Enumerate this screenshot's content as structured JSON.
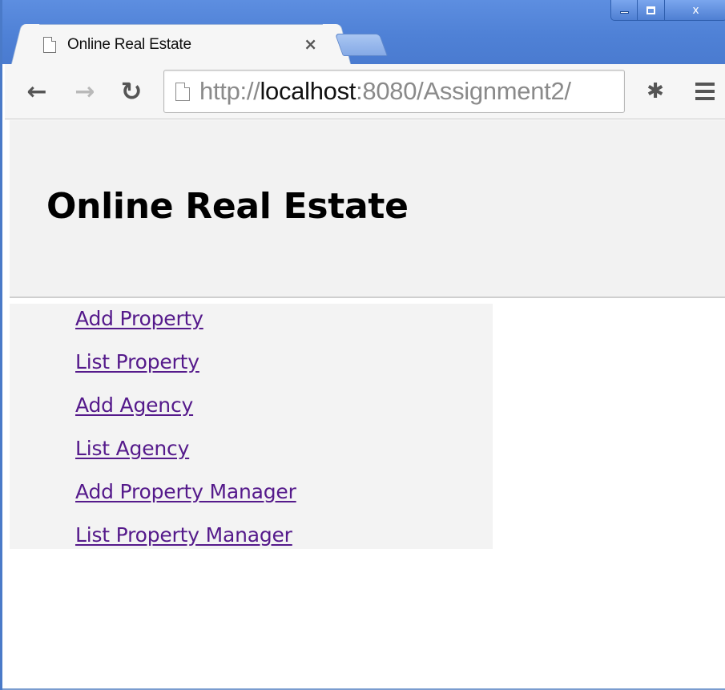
{
  "browser": {
    "tab": {
      "title": "Online Real Estate",
      "close_glyph": "×"
    },
    "window_controls": {
      "close_glyph": "x"
    },
    "nav": {
      "back_glyph": "←",
      "forward_glyph": "→",
      "reload_glyph": "↻"
    },
    "address": {
      "scheme": "http://",
      "host": "localhost",
      "rest": ":8080/Assignment2/"
    },
    "extension_glyph": "✱"
  },
  "page": {
    "title": "Online Real Estate",
    "links": [
      {
        "label": "Add Property"
      },
      {
        "label": "List Property"
      },
      {
        "label": "Add Agency"
      },
      {
        "label": "List Agency"
      },
      {
        "label": "Add Property Manager"
      },
      {
        "label": "List Property Manager"
      }
    ]
  },
  "colors": {
    "titlebar": "#4f81d6",
    "visited_link": "#551a8b",
    "header_band": "#f2f2f2",
    "nav_panel": "#f3f3f3"
  },
  "icons": [
    "page-icon",
    "close-icon",
    "back-arrow-icon",
    "forward-arrow-icon",
    "reload-icon",
    "extension-puzzle-icon",
    "menu-icon"
  ]
}
